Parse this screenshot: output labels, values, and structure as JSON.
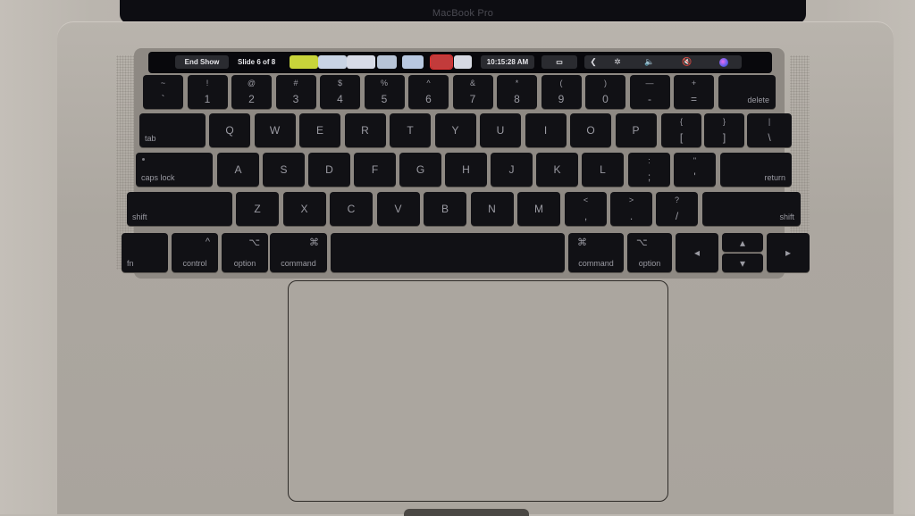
{
  "device": {
    "lid_brand": "MacBook Pro"
  },
  "touch_bar": {
    "end_show": "End Show",
    "slide_status": "Slide 6 of 8",
    "slide_thumbnails": [
      {
        "name": "slide-1",
        "color": "#c8d43a",
        "selected": false
      },
      {
        "name": "slide-2",
        "color": "#c9d4e4",
        "selected": false
      },
      {
        "name": "slide-3",
        "color": "#d7dbe6",
        "selected": false
      },
      {
        "name": "slide-4",
        "color": "#b7c4d6",
        "selected": false
      },
      {
        "name": "slide-5",
        "color": "#b8c8e0",
        "selected": false
      },
      {
        "name": "slide-6",
        "color": "#c23b3b",
        "selected": true
      },
      {
        "name": "slide-7",
        "color": "#d6d9e2",
        "selected": false
      }
    ],
    "clock": "10:15:28 AM",
    "icons": {
      "airplay": "airplay-icon",
      "expand": "chevron-left-icon",
      "brightness": "brightness-icon",
      "volume": "volume-icon",
      "mute": "mute-icon",
      "siri": "siri-icon"
    },
    "glyphs": {
      "expand": "❮",
      "brightness": "✲",
      "volume": "🔈",
      "mute": "🔇",
      "airplay": "▭"
    }
  },
  "keyboard": {
    "row_numbers": [
      {
        "top": "~",
        "bottom": "`"
      },
      {
        "top": "!",
        "bottom": "1"
      },
      {
        "top": "@",
        "bottom": "2"
      },
      {
        "top": "#",
        "bottom": "3"
      },
      {
        "top": "$",
        "bottom": "4"
      },
      {
        "top": "%",
        "bottom": "5"
      },
      {
        "top": "^",
        "bottom": "6"
      },
      {
        "top": "&",
        "bottom": "7"
      },
      {
        "top": "*",
        "bottom": "8"
      },
      {
        "top": "(",
        "bottom": "9"
      },
      {
        "top": ")",
        "bottom": "0"
      },
      {
        "top": "—",
        "bottom": "-"
      },
      {
        "top": "+",
        "bottom": "="
      }
    ],
    "delete": "delete",
    "tab": "tab",
    "row_qwerty": [
      "Q",
      "W",
      "E",
      "R",
      "T",
      "Y",
      "U",
      "I",
      "O",
      "P"
    ],
    "row_qwerty_sym": [
      {
        "top": "{",
        "bottom": "["
      },
      {
        "top": "}",
        "bottom": "]"
      },
      {
        "top": "|",
        "bottom": "\\"
      }
    ],
    "caps_lock": "caps lock",
    "row_home": [
      "A",
      "S",
      "D",
      "F",
      "G",
      "H",
      "J",
      "K",
      "L"
    ],
    "row_home_sym": [
      {
        "top": ":",
        "bottom": ";"
      },
      {
        "top": "\"",
        "bottom": "'"
      }
    ],
    "return": "return",
    "shift": "shift",
    "row_bottom": [
      "Z",
      "X",
      "C",
      "V",
      "B",
      "N",
      "M"
    ],
    "row_bottom_sym": [
      {
        "top": "<",
        "bottom": ","
      },
      {
        "top": ">",
        "bottom": "."
      },
      {
        "top": "?",
        "bottom": "/"
      }
    ],
    "fn": "fn",
    "control": "control",
    "control_sym": "^",
    "option": "option",
    "option_sym": "⌥",
    "command": "command",
    "command_sym": "⌘",
    "arrows": {
      "left": "◂",
      "up": "▴",
      "down": "▾",
      "right": "▸"
    }
  }
}
